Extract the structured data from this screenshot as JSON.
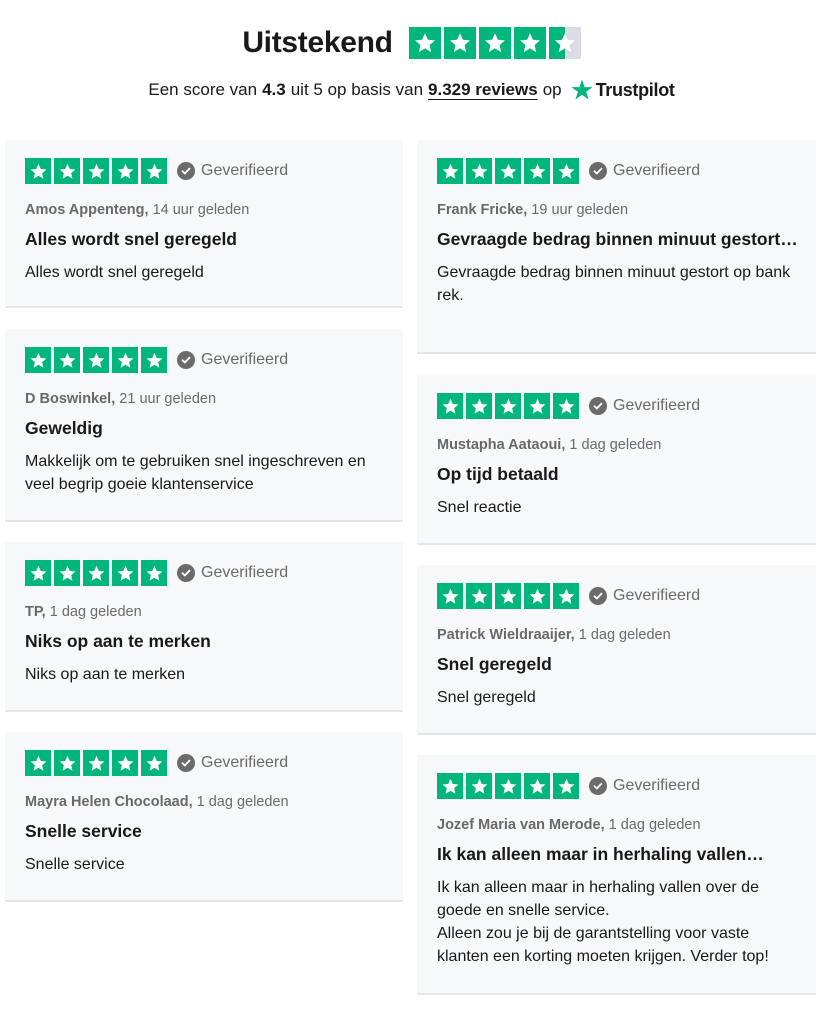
{
  "header": {
    "title": "Uitstekend",
    "score_prefix": "Een score van",
    "score_value": "4.3",
    "score_mid": "uit 5 op basis van",
    "reviews_count": "9.329 reviews",
    "score_suffix": "op",
    "brand": "Trustpilot",
    "rating": 4.5
  },
  "colors": {
    "star_green": "#00b67a",
    "star_gray": "#dcdce6",
    "card_bg": "#f7f8fa"
  },
  "verified_label": "Geverifieerd",
  "reviews": [
    {
      "author": "Amos Appenteng,",
      "time": "14 uur geleden",
      "title": "Alles wordt snel geregeld",
      "body": "Alles wordt snel geregeld",
      "stars": 5
    },
    {
      "author": "Frank Fricke,",
      "time": "19 uur geleden",
      "title": "Gevraagde bedrag binnen minuut gestort…",
      "body": "Gevraagde bedrag binnen minuut gestort op bank rek.",
      "stars": 5
    },
    {
      "author": "D Boswinkel,",
      "time": "21 uur geleden",
      "title": "Geweldig",
      "body": "Makkelijk om te gebruiken snel ingeschreven en veel begrip goeie klantenservice",
      "stars": 5
    },
    {
      "author": "Mustapha Aataoui,",
      "time": "1 dag geleden",
      "title": "Op tijd betaald",
      "body": "Snel reactie",
      "stars": 5
    },
    {
      "author": "TP,",
      "time": "1 dag geleden",
      "title": "Niks op aan te merken",
      "body": "Niks op aan te merken",
      "stars": 5
    },
    {
      "author": "Patrick Wieldraaijer,",
      "time": "1 dag geleden",
      "title": "Snel geregeld",
      "body": "Snel geregeld",
      "stars": 5
    },
    {
      "author": "Mayra Helen Chocolaad,",
      "time": "1 dag geleden",
      "title": "Snelle service",
      "body": "Snelle service",
      "stars": 5
    },
    {
      "author": "Jozef Maria van Merode,",
      "time": "1 dag geleden",
      "title": "Ik kan alleen maar in herhaling vallen…",
      "body": "Ik kan alleen maar in herhaling vallen over de goede en snelle service.\nAlleen zou je bij de garantstelling voor vaste klanten een korting moeten krijgen. Verder top!",
      "stars": 5
    }
  ]
}
